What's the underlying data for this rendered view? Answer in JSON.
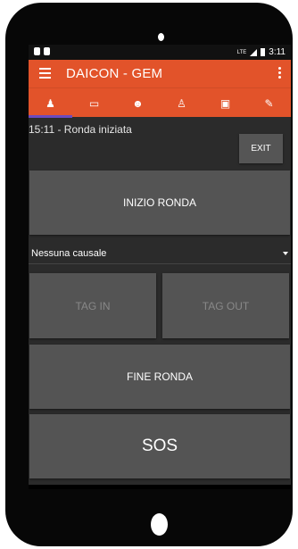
{
  "status_bar": {
    "network": "LTE",
    "time": "3:11"
  },
  "app_bar": {
    "title": "DAICON - GEM"
  },
  "tabs": [
    {
      "icon": "person-pin-icon",
      "glyph": "♟",
      "active": true
    },
    {
      "icon": "chat-icon",
      "glyph": "▭",
      "active": false
    },
    {
      "icon": "group-icon",
      "glyph": "☻",
      "active": false
    },
    {
      "icon": "person-icon",
      "glyph": "♙",
      "active": false
    },
    {
      "icon": "calendar-icon",
      "glyph": "▣",
      "active": false
    },
    {
      "icon": "edit-icon",
      "glyph": "✎",
      "active": false
    }
  ],
  "main": {
    "status_text": "15:11 - Ronda iniziata",
    "exit_label": "EXIT",
    "start_round_label": "INIZIO RONDA",
    "reason_select_value": "Nessuna causale",
    "tag_in_label": "TAG IN",
    "tag_out_label": "TAG OUT",
    "end_round_label": "FINE RONDA",
    "sos_label": "SOS"
  },
  "colors": {
    "accent": "#e2532a",
    "tab_indicator": "#6b4bbf",
    "button": "#545454",
    "background": "#2b2b2b"
  }
}
